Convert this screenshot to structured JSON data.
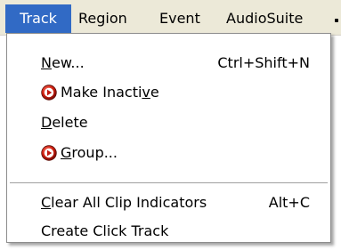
{
  "menubar": {
    "items": [
      {
        "label": "Track",
        "active": true
      },
      {
        "label": "Region"
      },
      {
        "label": "Event"
      },
      {
        "label": "AudioSuite"
      }
    ]
  },
  "dropdown": {
    "items": [
      {
        "label": "New...",
        "mnemonic": "N",
        "shortcut": "Ctrl+Shift+N"
      },
      {
        "label": "Make Inactive",
        "mnemonic": "v",
        "icon": "red-circle-arrow-icon"
      },
      {
        "label": "Delete",
        "mnemonic": "D"
      },
      {
        "label": "Group...",
        "mnemonic": "G",
        "icon": "red-circle-arrow-icon"
      },
      {
        "label": "Clear All Clip Indicators",
        "mnemonic": "C",
        "shortcut": "Alt+C"
      },
      {
        "label": "Create Click Track"
      }
    ]
  },
  "colors": {
    "menubar_bg": "#ece9d8",
    "highlight_bg": "#316ac5",
    "highlight_text": "#ffffff",
    "icon_red": "#c81414"
  }
}
